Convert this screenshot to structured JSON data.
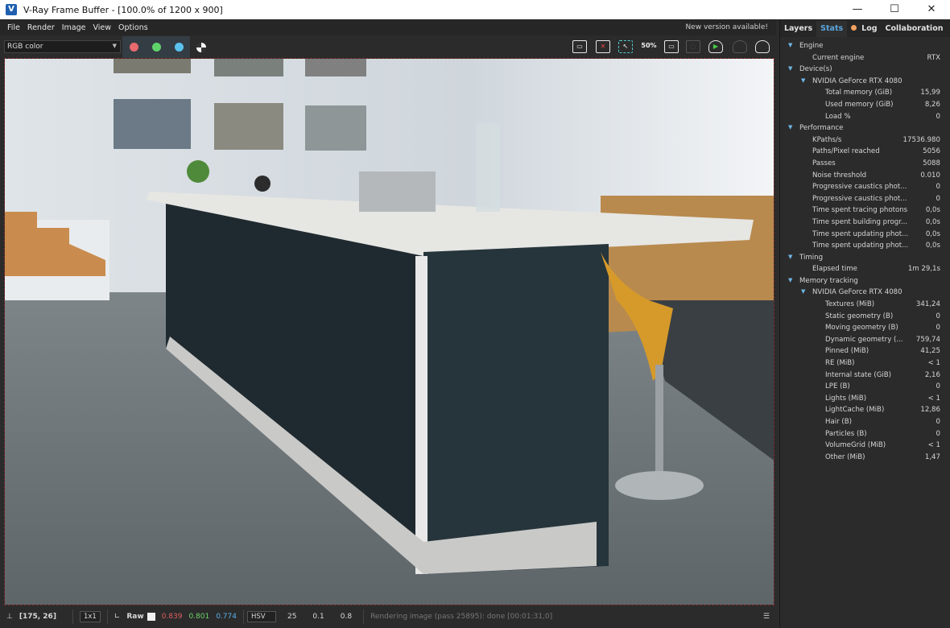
{
  "window": {
    "title": "V-Ray Frame Buffer - [100.0% of 1200 x 900]",
    "minimize": "—",
    "maximize": "☐",
    "close": "✕"
  },
  "menu": [
    "File",
    "Render",
    "Image",
    "View",
    "Options"
  ],
  "notice": "New version available!",
  "toolbar": {
    "channel": "RGB color",
    "colors": {
      "red": "#e8696e",
      "green": "#5fd46a",
      "blue": "#5bc2ee"
    },
    "icons": [
      "save-icon",
      "clear-image-icon",
      "region-render-icon",
      "zoom-50-icon",
      "frame-icon",
      "interactive-render-icon",
      "render-icon",
      "stop-render-icon",
      "render-last-icon"
    ],
    "zoom_label": "50%"
  },
  "tabs": {
    "layers": "Layers",
    "stats": "Stats",
    "log": "Log",
    "collaboration": "Collaboration"
  },
  "stats": [
    {
      "l": 0,
      "label": "Engine",
      "group": true
    },
    {
      "l": 1,
      "label": "Current engine",
      "value": "RTX"
    },
    {
      "l": 0,
      "label": "Device(s)",
      "group": true
    },
    {
      "l": 1,
      "label": "NVIDIA GeForce RTX 4080",
      "group": true
    },
    {
      "l": 2,
      "label": "Total memory (GiB)",
      "value": "15,99"
    },
    {
      "l": 2,
      "label": "Used memory (GiB)",
      "value": "8,26"
    },
    {
      "l": 2,
      "label": "Load %",
      "value": "0"
    },
    {
      "l": 0,
      "label": "Performance",
      "group": true
    },
    {
      "l": 1,
      "label": "KPaths/s",
      "value": "17536.980"
    },
    {
      "l": 1,
      "label": "Paths/Pixel reached",
      "value": "5056"
    },
    {
      "l": 1,
      "label": "Passes",
      "value": "5088"
    },
    {
      "l": 1,
      "label": "Noise threshold",
      "value": "0.010"
    },
    {
      "l": 1,
      "label": "Progressive caustics phot...",
      "value": "0"
    },
    {
      "l": 1,
      "label": "Progressive caustics phot...",
      "value": "0"
    },
    {
      "l": 1,
      "label": "Time spent tracing photons",
      "value": "0,0s"
    },
    {
      "l": 1,
      "label": "Time spent building progr...",
      "value": "0,0s"
    },
    {
      "l": 1,
      "label": "Time spent updating phot...",
      "value": "0,0s"
    },
    {
      "l": 1,
      "label": "Time spent updating phot...",
      "value": "0,0s"
    },
    {
      "l": 0,
      "label": "Timing",
      "group": true
    },
    {
      "l": 1,
      "label": "Elapsed time",
      "value": "1m 29,1s"
    },
    {
      "l": 0,
      "label": "Memory tracking",
      "group": true
    },
    {
      "l": 1,
      "label": "NVIDIA GeForce RTX 4080",
      "group": true
    },
    {
      "l": 2,
      "label": "Textures (MiB)",
      "value": "341,24"
    },
    {
      "l": 2,
      "label": "Static geometry (B)",
      "value": "0"
    },
    {
      "l": 2,
      "label": "Moving geometry (B)",
      "value": "0"
    },
    {
      "l": 2,
      "label": "Dynamic geometry (...",
      "value": "759,74"
    },
    {
      "l": 2,
      "label": "Pinned (MiB)",
      "value": "41,25"
    },
    {
      "l": 2,
      "label": "RE (MiB)",
      "value": "< 1"
    },
    {
      "l": 2,
      "label": "Internal state (GiB)",
      "value": "2,16"
    },
    {
      "l": 2,
      "label": "LPE (B)",
      "value": "0"
    },
    {
      "l": 2,
      "label": "Lights (MiB)",
      "value": "< 1"
    },
    {
      "l": 2,
      "label": "LightCache (MiB)",
      "value": "12,86"
    },
    {
      "l": 2,
      "label": "Hair (B)",
      "value": "0"
    },
    {
      "l": 2,
      "label": "Particles (B)",
      "value": "0"
    },
    {
      "l": 2,
      "label": "VolumeGrid (MiB)",
      "value": "< 1"
    },
    {
      "l": 2,
      "label": "Other (MiB)",
      "value": "1,47"
    }
  ],
  "status": {
    "coords": "[175, 26]",
    "sampling": "1x1",
    "raw": "Raw",
    "r": "0.839",
    "g": "0.801",
    "b": "0.774",
    "colorspace": "HSV",
    "h": "25",
    "s": "0.1",
    "v": "0.8",
    "message": "Rendering image (pass 25895): done [00:01:31,0]"
  }
}
